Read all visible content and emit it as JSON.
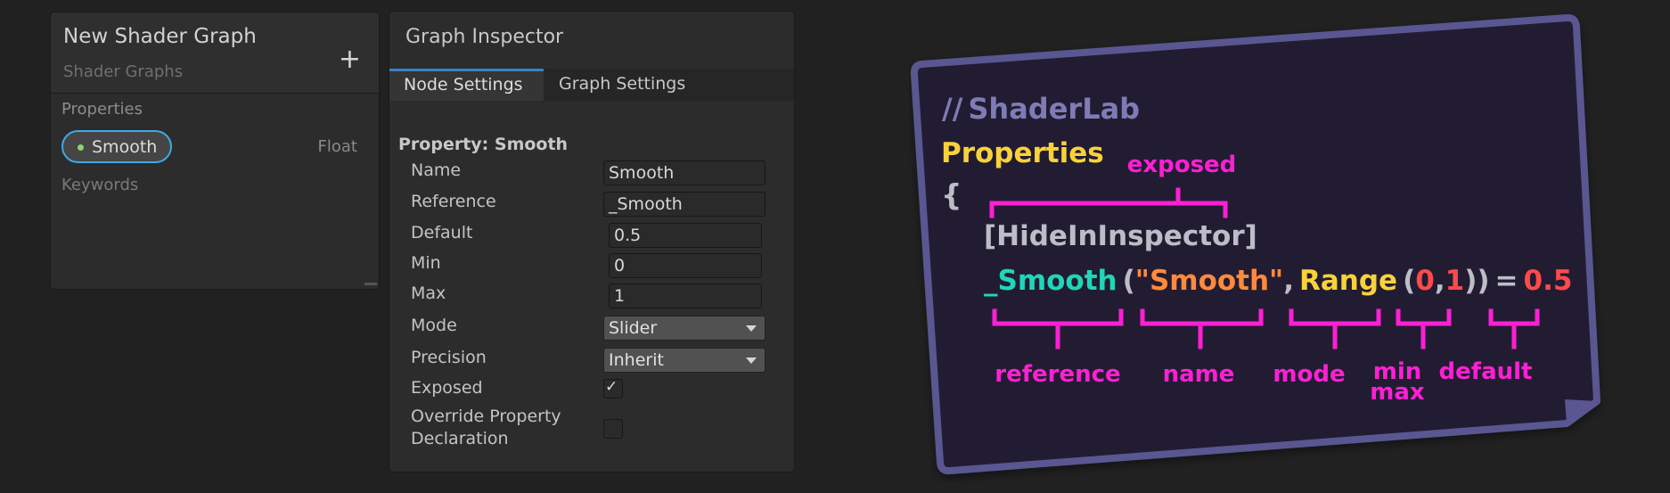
{
  "blackboard": {
    "title": "New Shader Graph",
    "subtitle": "Shader Graphs",
    "add_symbol": "+",
    "category_properties": "Properties",
    "property": {
      "name": "Smooth",
      "type": "Float"
    },
    "category_keywords": "Keywords"
  },
  "inspector": {
    "title": "Graph Inspector",
    "tabs": [
      {
        "label": "Node Settings",
        "active": true
      },
      {
        "label": "Graph Settings",
        "active": false
      }
    ],
    "section_title": "Property: Smooth",
    "rows": {
      "name": {
        "label": "Name",
        "value": "Smooth"
      },
      "reference": {
        "label": "Reference",
        "value": "_Smooth"
      },
      "default": {
        "label": "Default",
        "value": "0.5"
      },
      "min": {
        "label": "Min",
        "value": "0"
      },
      "max": {
        "label": "Max",
        "value": "1"
      },
      "mode": {
        "label": "Mode",
        "value": "Slider"
      },
      "precision": {
        "label": "Precision",
        "value": "Inherit"
      },
      "exposed": {
        "label": "Exposed",
        "checked": true,
        "check_glyph": "✓"
      },
      "override": {
        "label_line1": "Override Property",
        "label_line2": "Declaration",
        "checked": false
      }
    }
  },
  "card": {
    "comment_slashes": "//",
    "comment_text": "ShaderLab",
    "properties_keyword": "Properties",
    "brace": "{",
    "attribute": "[HideInInspector]",
    "reference": "_Smooth",
    "open_paren": "(",
    "name_string": "\"Smooth\"",
    "comma": ",",
    "range_keyword": "Range",
    "range_open": "(",
    "min_value": "0",
    "range_comma": ",",
    "max_value": "1",
    "close_parens": "))",
    "equals": "=",
    "default_value": "0.5",
    "annotations": {
      "exposed": "exposed",
      "reference": "reference",
      "name": "name",
      "mode": "mode",
      "min": "min",
      "max": "max",
      "default": "default"
    },
    "colors": {
      "background": "#201d33",
      "border": "#5a5691",
      "comment": "#7f7bb6",
      "keyword": "#f9d23a",
      "reference": "#1fd6b9",
      "string": "#ff8a3d",
      "number": "#ff4a4a",
      "attribute": "#bdbdc7",
      "annotation": "#ff1fd4"
    }
  }
}
